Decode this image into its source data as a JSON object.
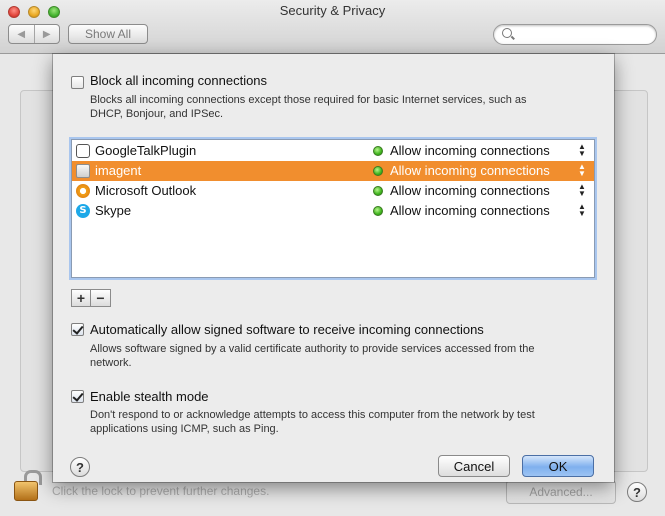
{
  "window": {
    "title": "Security & Privacy",
    "nav_back": "◀",
    "nav_forward": "▶",
    "show_all_label": "Show All",
    "search_placeholder": ""
  },
  "background": {
    "lock_text": "Click the lock to prevent further changes.",
    "advanced_label": "Advanced...",
    "help_label": "?"
  },
  "sheet": {
    "block_all": {
      "checked": false,
      "label": "Block all incoming connections",
      "description": "Blocks all incoming connections except those required for basic Internet services, such as DHCP, Bonjour, and IPSec."
    },
    "apps": [
      {
        "name": "GoogleTalkPlugin",
        "status": "Allow incoming connections",
        "icon": "chat-bubble-icon",
        "selected": false
      },
      {
        "name": "imagent",
        "status": "Allow incoming connections",
        "icon": "imagent-icon",
        "selected": true
      },
      {
        "name": "Microsoft Outlook",
        "status": "Allow incoming connections",
        "icon": "outlook-icon",
        "selected": false
      },
      {
        "name": "Skype",
        "status": "Allow incoming connections",
        "icon": "skype-icon",
        "selected": false
      }
    ],
    "add_label": "+",
    "remove_label": "−",
    "auto_allow": {
      "checked": true,
      "label": "Automatically allow signed software to receive incoming connections",
      "description": "Allows software signed by a valid certificate authority to provide services accessed from the network."
    },
    "stealth": {
      "checked": true,
      "label": "Enable stealth mode",
      "description": "Don't respond to or acknowledge attempts to access this computer from the network by test applications using ICMP, such as Ping."
    },
    "help_label": "?",
    "cancel_label": "Cancel",
    "ok_label": "OK"
  },
  "colors": {
    "selection": "#f18e2e",
    "status_dot": "#3fb41d",
    "focus_ring": "#a9c6ee"
  }
}
